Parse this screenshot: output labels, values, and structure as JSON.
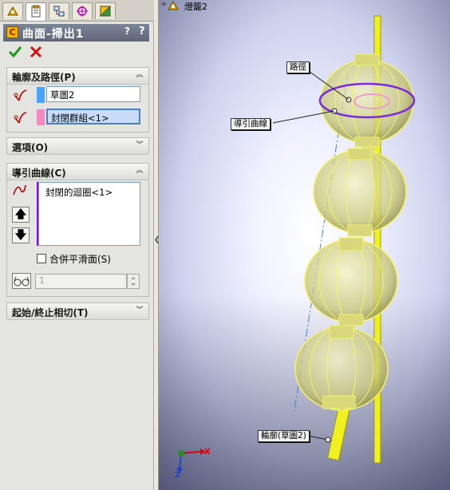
{
  "panel": {
    "tabs": [
      "feature-manager-icon",
      "property-manager-icon",
      "configuration-manager-icon",
      "dimxpert-icon",
      "display-manager-icon"
    ],
    "title": "曲面-掃出1",
    "help_label": "?",
    "help_label2": "?",
    "ok_icon": "checkmark-icon",
    "cancel_icon": "x-icon",
    "profile_path": {
      "title": "輪廓及路徑(P)",
      "profile_value": "草圖2",
      "path_value": "封閉群組<1>",
      "profile_color": "#4aa3ff",
      "path_color": "#f08ac0"
    },
    "options": {
      "title": "選項(O)"
    },
    "guide_curves": {
      "title": "導引曲線(C)",
      "items": [
        "封閉的迴圈<1>"
      ],
      "color": "#8a00ff",
      "merge_label": "合併平滑面(S)",
      "merge_checked": false,
      "spin_value": "1"
    },
    "tangency": {
      "title": "起始/終止相切(T)"
    }
  },
  "viewport": {
    "tree_label": "燈籠2",
    "callouts": {
      "path": "路徑",
      "guide": "導引曲線",
      "profile": "輪廓(草圖2)"
    },
    "axis_labels": {
      "x": "X",
      "z": "Z"
    },
    "colors": {
      "lantern": "#f3f36a",
      "guide": "#7a2cd9",
      "path": "#f09ad2"
    }
  }
}
